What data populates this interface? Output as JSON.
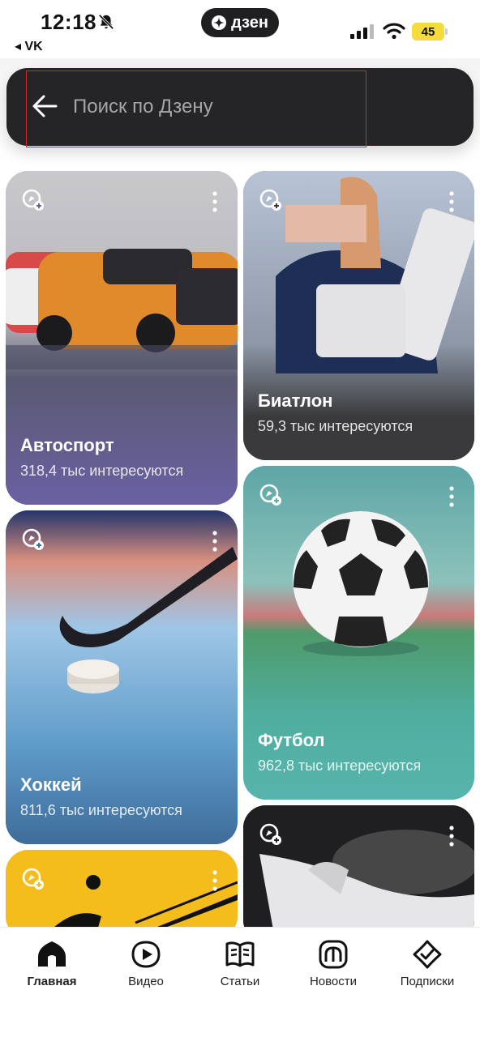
{
  "status_bar": {
    "time": "12:18",
    "back_app": "◂ VK",
    "zen_label": "дзен",
    "battery": "45"
  },
  "search": {
    "placeholder": "Поиск по Дзену"
  },
  "cards": [
    {
      "title": "Автоспорт",
      "meta": "318,4 тыс интересуются"
    },
    {
      "title": "Биатлон",
      "meta": "59,3 тыс интересуются"
    },
    {
      "title": "Хоккей",
      "meta": "811,6 тыс интересуются"
    },
    {
      "title": "Футбол",
      "meta": "962,8 тыс интересуются"
    }
  ],
  "tabbar": {
    "items": [
      {
        "label": "Главная",
        "icon": "home-icon",
        "active": true
      },
      {
        "label": "Видео",
        "icon": "video-icon",
        "active": false
      },
      {
        "label": "Статьи",
        "icon": "articles-icon",
        "active": false
      },
      {
        "label": "Новости",
        "icon": "news-icon",
        "active": false
      },
      {
        "label": "Подписки",
        "icon": "subscriptions-icon",
        "active": false
      }
    ]
  },
  "colors": {
    "search_bg": "#252527",
    "battery": "#f3dc3b",
    "autosport_card": "#6a60a3",
    "biathlon_card": "#3a3a3c",
    "hockey_card": "#3e6c9b",
    "football_card": "#57b4ad"
  }
}
